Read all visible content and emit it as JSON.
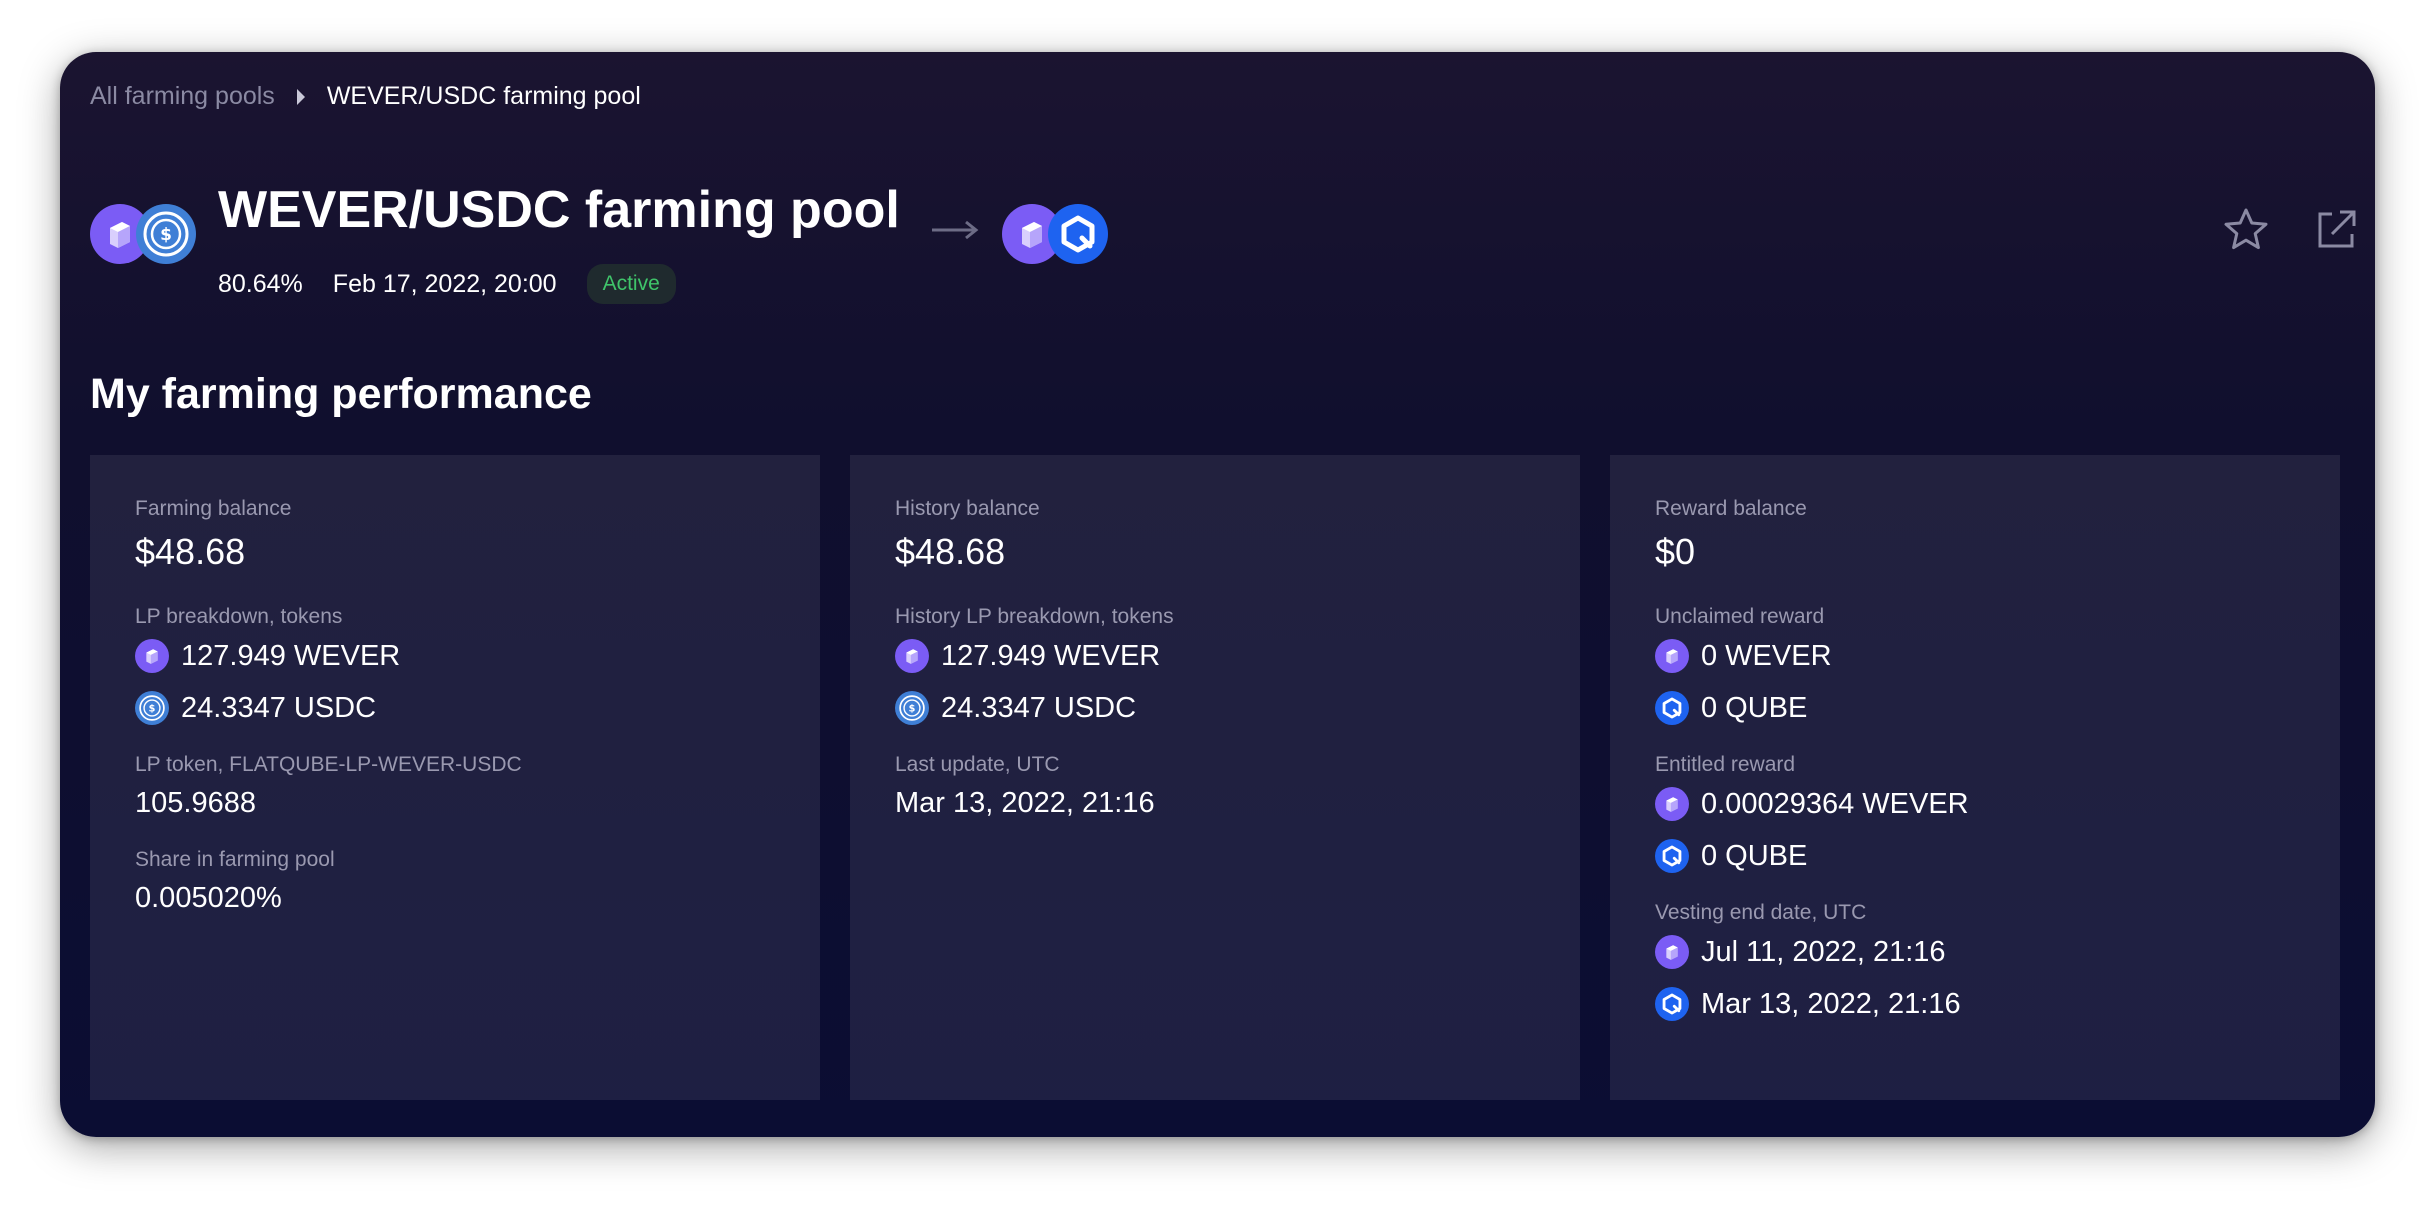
{
  "breadcrumb": {
    "parent": "All farming pools",
    "current": "WEVER/USDC farming pool"
  },
  "pool": {
    "title": "WEVER/USDC farming pool",
    "apr": "80.64%",
    "date": "Feb 17, 2022, 20:00",
    "status": "Active",
    "pair_icons": [
      "wever-icon",
      "usdc-icon"
    ],
    "reward_icons": [
      "wever-icon",
      "qube-icon"
    ]
  },
  "section_title": "My farming performance",
  "colors": {
    "accent_wever": "#7b5cf5",
    "accent_qube": "#1e63f0",
    "usdc": "#3f7fd6",
    "active": "#3fc46a"
  },
  "cards": [
    {
      "fields": [
        {
          "label": "Farming balance",
          "value": "$48.68",
          "kind": "big"
        },
        {
          "label": "LP breakdown, tokens",
          "kind": "tokens",
          "tokens": [
            {
              "icon": "wever-icon",
              "text": "127.949 WEVER"
            },
            {
              "icon": "usdc-icon",
              "text": "24.3347 USDC"
            }
          ]
        },
        {
          "label": "LP token, FLATQUBE-LP-WEVER-USDC",
          "value": "105.9688",
          "kind": "val"
        },
        {
          "label": "Share in farming pool",
          "value": "0.005020%",
          "kind": "val"
        }
      ]
    },
    {
      "fields": [
        {
          "label": "History balance",
          "value": "$48.68",
          "kind": "big"
        },
        {
          "label": "History LP breakdown, tokens",
          "kind": "tokens",
          "tokens": [
            {
              "icon": "wever-icon",
              "text": "127.949 WEVER"
            },
            {
              "icon": "usdc-icon",
              "text": "24.3347 USDC"
            }
          ]
        },
        {
          "label": "Last update, UTC",
          "value": "Mar 13, 2022, 21:16",
          "kind": "val"
        }
      ]
    },
    {
      "fields": [
        {
          "label": "Reward balance",
          "value": "$0",
          "kind": "big"
        },
        {
          "label": "Unclaimed reward",
          "kind": "tokens",
          "tokens": [
            {
              "icon": "wever-icon",
              "text": "0 WEVER"
            },
            {
              "icon": "qube-icon",
              "text": "0 QUBE"
            }
          ]
        },
        {
          "label": "Entitled reward",
          "kind": "tokens",
          "tokens": [
            {
              "icon": "wever-icon",
              "text": "0.00029364 WEVER"
            },
            {
              "icon": "qube-icon",
              "text": "0 QUBE"
            }
          ]
        },
        {
          "label": "Vesting end date, UTC",
          "kind": "tokens",
          "tokens": [
            {
              "icon": "wever-icon",
              "text": "Jul 11, 2022, 21:16"
            },
            {
              "icon": "qube-icon",
              "text": "Mar 13, 2022, 21:16"
            }
          ]
        }
      ]
    }
  ]
}
